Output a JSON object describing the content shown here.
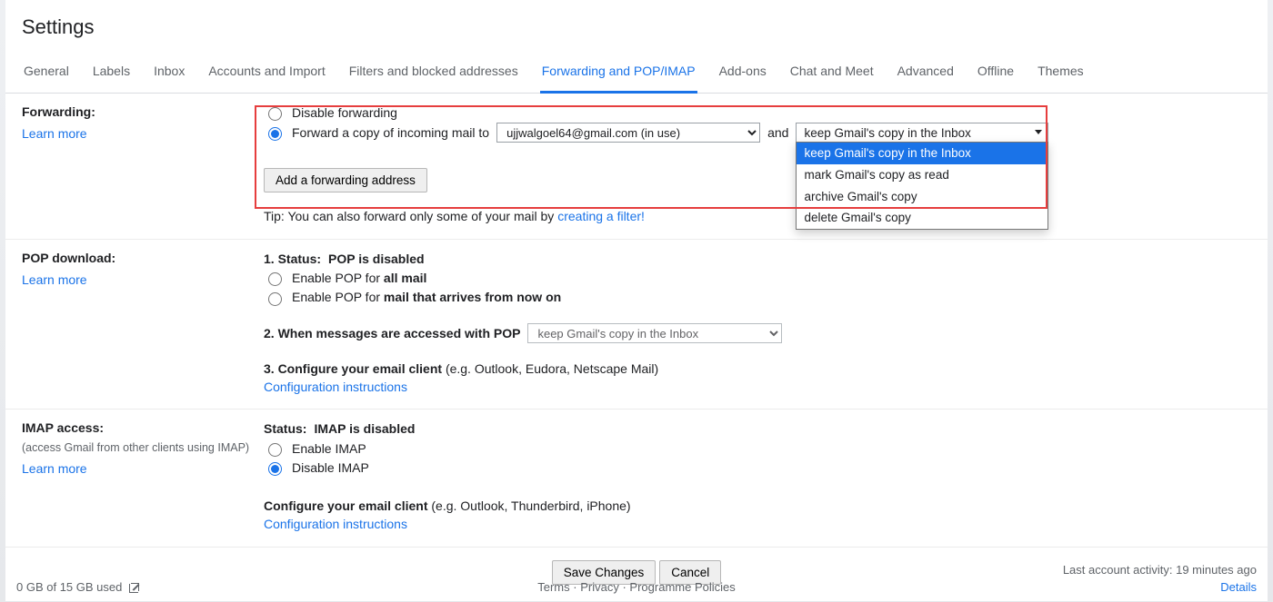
{
  "header": {
    "title": "Settings"
  },
  "tabs": [
    "General",
    "Labels",
    "Inbox",
    "Accounts and Import",
    "Filters and blocked addresses",
    "Forwarding and POP/IMAP",
    "Add-ons",
    "Chat and Meet",
    "Advanced",
    "Offline",
    "Themes"
  ],
  "common": {
    "learn_more": "Learn more",
    "config_instructions": "Configuration instructions"
  },
  "forwarding": {
    "label": "Forwarding:",
    "disable": "Disable forwarding",
    "forward_prefix": "Forward a copy of incoming mail to",
    "address_selected": "ujjwalgoel64@gmail.com (in use)",
    "and": "and",
    "action_selected": "keep Gmail's copy in the Inbox",
    "action_options": [
      "keep Gmail's copy in the Inbox",
      "mark Gmail's copy as read",
      "archive Gmail's copy",
      "delete Gmail's copy"
    ],
    "add_button": "Add a forwarding address",
    "tip_prefix": "Tip: You can also forward only some of your mail by ",
    "tip_link": "creating a filter!"
  },
  "pop": {
    "label": "POP download:",
    "status_prefix": "1. Status:",
    "status_value": "POP is disabled",
    "enable_all_prefix": "Enable POP for ",
    "enable_all_bold": "all mail",
    "enable_now_prefix": "Enable POP for ",
    "enable_now_bold": "mail that arrives from now on",
    "step2": "2. When messages are accessed with POP",
    "step2_selected": "keep Gmail's copy in the Inbox",
    "step3_bold": "3. Configure your email client",
    "step3_rest": " (e.g. Outlook, Eudora, Netscape Mail)"
  },
  "imap": {
    "label": "IMAP access:",
    "sub": "(access Gmail from other clients using IMAP)",
    "status_prefix": "Status:",
    "status_value": "IMAP is disabled",
    "enable": "Enable IMAP",
    "disable": "Disable IMAP",
    "config_bold": "Configure your email client",
    "config_rest": " (e.g. Outlook, Thunderbird, iPhone)"
  },
  "buttons": {
    "save": "Save Changes",
    "cancel": "Cancel"
  },
  "footer": {
    "storage": "0 GB of 15 GB used",
    "links": [
      "Terms",
      "Privacy",
      "Programme Policies"
    ],
    "activity": "Last account activity: 19 minutes ago",
    "details": "Details"
  }
}
